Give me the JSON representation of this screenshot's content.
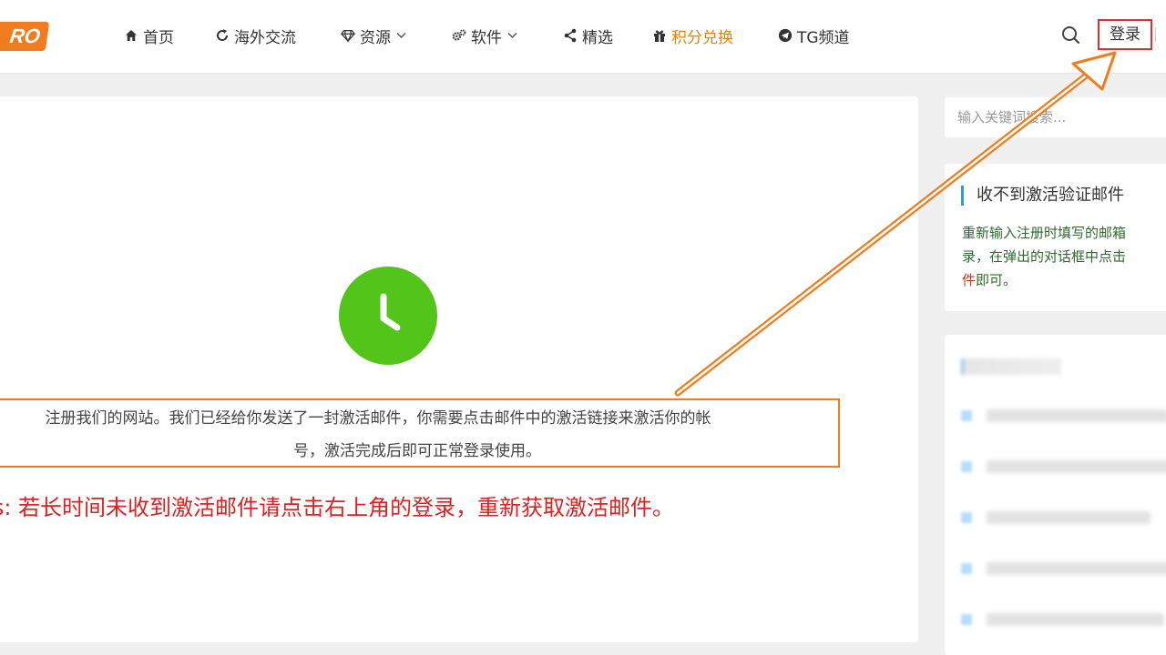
{
  "header": {
    "logo_text": "RO",
    "nav": [
      {
        "icon": "home-icon",
        "label": "首页",
        "has_dropdown": false,
        "highlight": false
      },
      {
        "icon": "refresh-icon",
        "label": "海外交流",
        "has_dropdown": false,
        "highlight": false
      },
      {
        "icon": "diamond-icon",
        "label": "资源",
        "has_dropdown": true,
        "highlight": false
      },
      {
        "icon": "gears-icon",
        "label": "软件",
        "has_dropdown": true,
        "highlight": false
      },
      {
        "icon": "share-icon",
        "label": "精选",
        "has_dropdown": false,
        "highlight": false
      },
      {
        "icon": "gift-icon",
        "label": "积分兑换",
        "has_dropdown": false,
        "highlight": true
      },
      {
        "icon": "telegram-icon",
        "label": "TG频道",
        "has_dropdown": false,
        "highlight": false
      }
    ],
    "login_label": "登录"
  },
  "main": {
    "status_icon": "clock-icon",
    "message_line1": "注册我们的网站。我们已经给你发送了一封激活邮件，你需要点击邮件中的激活链接来激活你的帐",
    "message_line2": "号，激活完成后即可正常登录使用。",
    "tips": "Tips: 若长时间未收到激活邮件请点击右上角的登录，重新获取激活邮件。"
  },
  "sidebar": {
    "search_placeholder": "输入关键词搜索...",
    "activation_widget": {
      "title": "收不到激活验证邮件",
      "line1": "重新输入注册时填写的邮箱",
      "line2": "录，在弹出的对话框中点击",
      "line3_red": "件",
      "line3_rest": "即可。"
    }
  },
  "colors": {
    "accent_orange": "#f07c1d",
    "highlight_nav": "#e8820c",
    "tips_red": "#e02020",
    "login_border": "#e03030",
    "clock_green": "#52c41a",
    "widget_accent": "#2b9af3",
    "widget_text": "#2d6a2d"
  }
}
